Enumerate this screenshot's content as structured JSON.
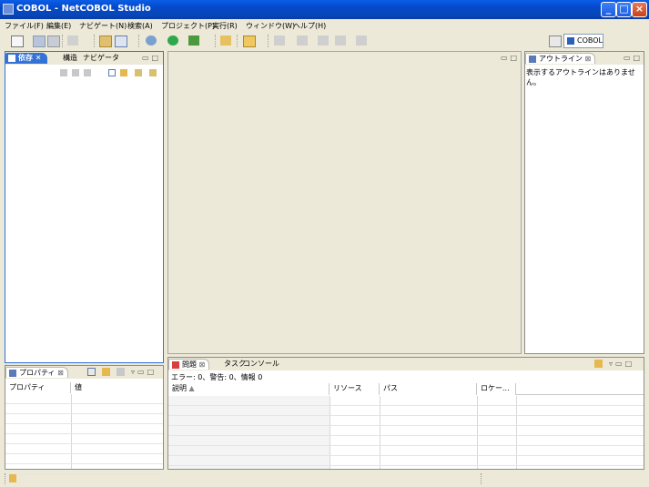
{
  "window": {
    "title": "COBOL - NetCOBOL Studio"
  },
  "menu": [
    "ファイル(F)",
    "編集(E)",
    "ナビゲート(N)",
    "検索(A)",
    "プロジェクト(P)",
    "実行(R)",
    "ウィンドウ(W)",
    "ヘルプ(H)"
  ],
  "toolbar": {
    "perspective_label": "COBOL"
  },
  "left_pane": {
    "tabs": [
      "依存",
      "構造",
      "ナビゲータ"
    ],
    "active_tab_close": "✕"
  },
  "outline": {
    "tab": "アウトライン",
    "message": "表示するアウトラインはありません。"
  },
  "properties": {
    "tab": "プロパティ",
    "col_property": "プロパティ",
    "col_value": "値"
  },
  "problems": {
    "tabs": [
      "問題",
      "タスク",
      "コンソール"
    ],
    "summary": "エラー: 0、警告: 0、情報 0",
    "columns": [
      "説明",
      "リソース",
      "パス",
      "ロケー..."
    ]
  },
  "colors": {
    "accent": "#3472d6",
    "title": "#0548c9",
    "chrome": "#ece9d8"
  }
}
